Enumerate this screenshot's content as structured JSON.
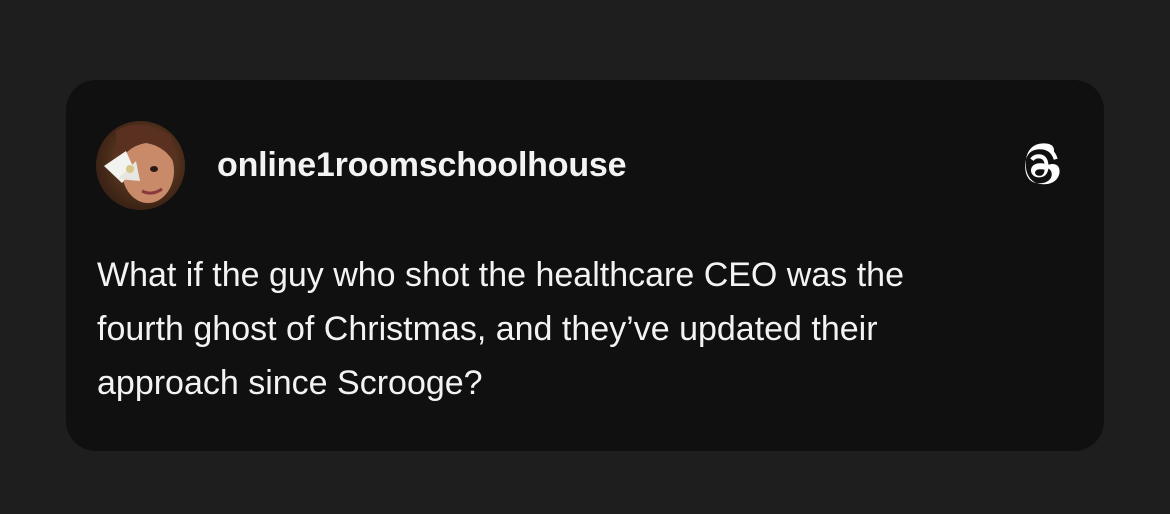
{
  "post": {
    "username": "online1roomschoolhouse",
    "text": "What if the guy who shot the healthcare CEO was the\nfourth ghost of Christmas, and they’ve updated their\napproach since Scrooge?",
    "avatar_icon": "profile-photo",
    "platform_icon": "threads-icon"
  },
  "colors": {
    "page_background": "#1e1e1e",
    "card_background": "#101010",
    "text": "#f3f3f3"
  }
}
